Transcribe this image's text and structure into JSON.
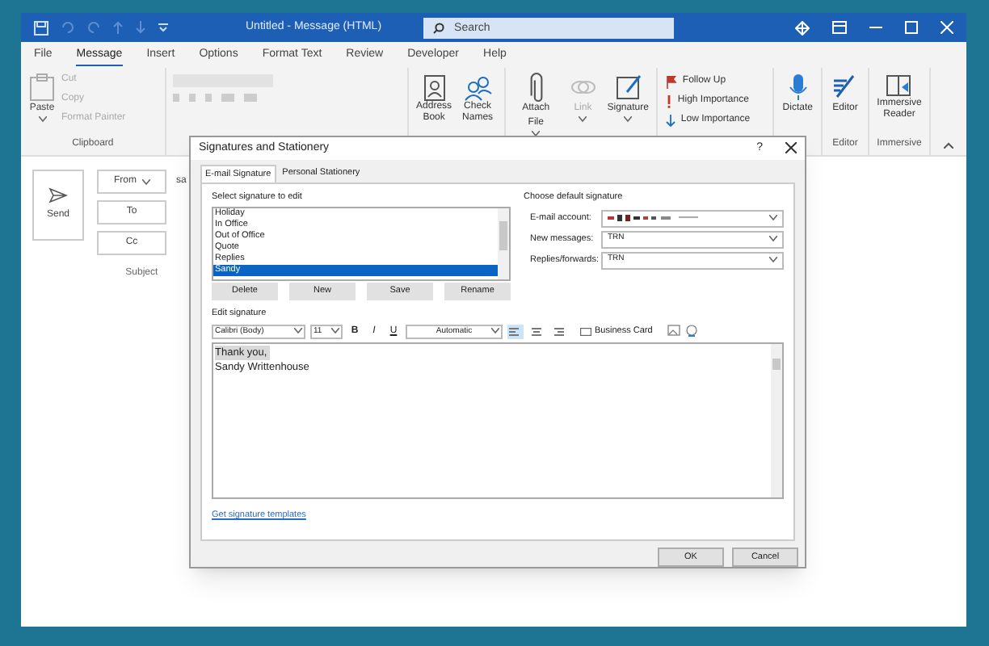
{
  "window": {
    "title": "Untitled  -  Message (HTML)",
    "search": {
      "placeholder": "Search"
    }
  },
  "menu_tabs": [
    {
      "label": "File",
      "selected": false
    },
    {
      "label": "Message",
      "selected": true
    },
    {
      "label": "Insert",
      "selected": false
    },
    {
      "label": "Options",
      "selected": false
    },
    {
      "label": "Format Text",
      "selected": false
    },
    {
      "label": "Review",
      "selected": false
    },
    {
      "label": "Developer",
      "selected": false
    },
    {
      "label": "Help",
      "selected": false
    }
  ],
  "ribbon": {
    "clipboard": {
      "paste": "Paste",
      "items": [
        {
          "label": "Cut",
          "disabled": true
        },
        {
          "label": "Copy",
          "disabled": true
        },
        {
          "label": "Format Painter",
          "disabled": true
        }
      ],
      "group_label": "Clipboard"
    },
    "names": [
      {
        "label": "Address Book",
        "kind": "book"
      },
      {
        "label": "Check Names",
        "kind": "people"
      }
    ],
    "include": [
      {
        "label": "Attach File",
        "disabled": false,
        "kind": "clip"
      },
      {
        "label": "Link",
        "disabled": true,
        "kind": "link"
      },
      {
        "label": "Signature",
        "disabled": false,
        "kind": "pen"
      }
    ],
    "tags": [
      {
        "label": "Follow Up",
        "kind": "flag"
      },
      {
        "label": "High Importance",
        "kind": "high"
      },
      {
        "label": "Low Importance",
        "kind": "low"
      }
    ],
    "dictate": "Dictate",
    "editor": {
      "label": "Editor",
      "group_label": "Editor"
    },
    "immersive": {
      "label": "Immersive Reader",
      "group_label": "Immersive"
    }
  },
  "compose": {
    "send": "Send",
    "from": "From",
    "from_value": "sa",
    "to": "To",
    "cc": "Cc",
    "subject": "Subject"
  },
  "dialog": {
    "title": "Signatures and Stationery",
    "help": "?",
    "tabs": [
      {
        "label": "E-mail Signature",
        "selected": true
      },
      {
        "label": "Personal Stationery",
        "selected": false
      }
    ],
    "select_label": "Select signature to edit",
    "signatures": [
      {
        "name": "Holiday",
        "selected": false
      },
      {
        "name": "In Office",
        "selected": false
      },
      {
        "name": "Out of Office",
        "selected": false
      },
      {
        "name": "Quote",
        "selected": false
      },
      {
        "name": "Replies",
        "selected": false
      },
      {
        "name": "Sandy",
        "selected": true
      }
    ],
    "list_buttons": [
      "Delete",
      "New",
      "Save",
      "Rename"
    ],
    "defaults_label": "Choose default signature",
    "defaults": [
      {
        "label": "E-mail account:",
        "kind": "redacted"
      },
      {
        "label": "New messages:",
        "value": "TRN",
        "kind": "text"
      },
      {
        "label": "Replies/forwards:",
        "value": "TRN",
        "kind": "text"
      }
    ],
    "edit_label": "Edit signature",
    "toolbar": {
      "font": "Calibri (Body)",
      "size": "11",
      "bold": "B",
      "italic": "I",
      "underline": "U",
      "font_color_text": "Automatic",
      "align": [
        {
          "kind": "left",
          "selected": true
        },
        {
          "kind": "center",
          "selected": false
        },
        {
          "kind": "right",
          "selected": false
        }
      ],
      "business_card": "Business Card"
    },
    "signature_lines": [
      {
        "text": "Thank you,",
        "highlighted": true
      },
      {
        "text": "Sandy Writtenhouse",
        "highlighted": false
      }
    ],
    "templates_link": "Get signature templates",
    "buttons": [
      "OK",
      "Cancel"
    ]
  }
}
